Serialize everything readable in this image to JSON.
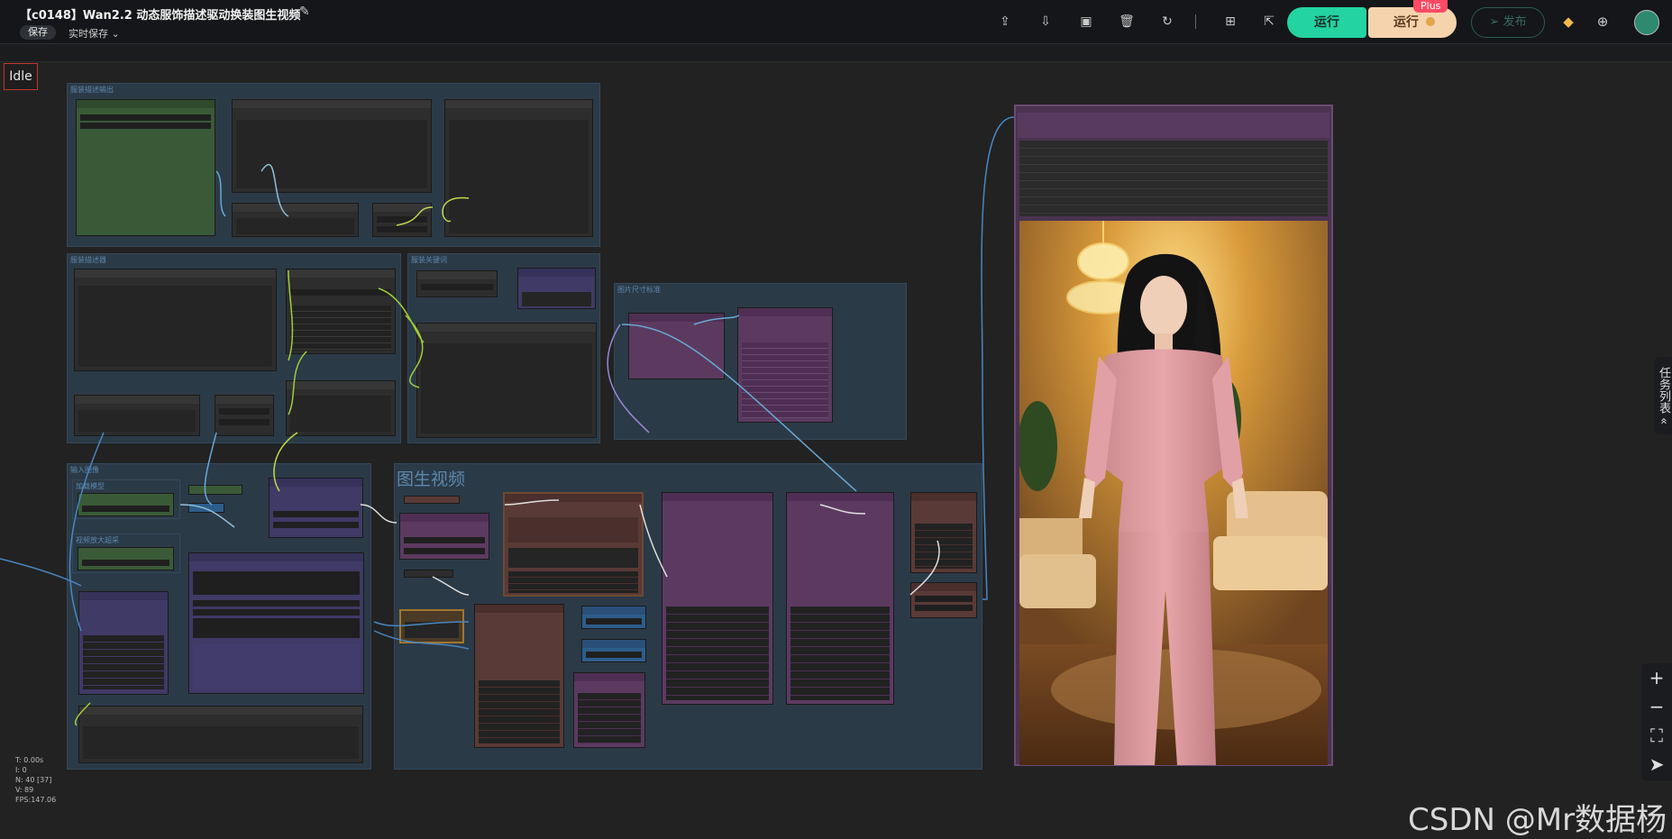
{
  "header": {
    "title": "【c0148】Wan2.2 动态服饰描述驱动换装图生视频",
    "save_label": "保存",
    "autosave_label": "实时保存",
    "run_label": "运行",
    "run_plus_label": "运行",
    "plus_badge": "Plus",
    "publish_label": "发布"
  },
  "icons": {
    "edit": "pencil-icon",
    "upload": "cloud-upload-icon",
    "download": "cloud-download-icon",
    "gallery": "gallery-icon",
    "delete": "trash-icon",
    "refresh": "refresh-icon",
    "grid": "grid-icon",
    "export": "export-icon"
  },
  "status": {
    "idle": "Idle"
  },
  "groups": {
    "g1": "服装描述输出",
    "g2": "服装描述器",
    "g3": "服装关键词",
    "g4": "图片尺寸标准",
    "g5": "输入图像",
    "g6": "图生视频",
    "sub1": "加载模型",
    "sub2": "视频放大超采"
  },
  "stats": {
    "t": "T: 0.00s",
    "i": "I: 0",
    "n": "N: 40 [37]",
    "v": "V: 89",
    "fps": "FPS:147.06"
  },
  "side_panel": {
    "label": "任务列表 «"
  },
  "watermark": "CSDN @Mr数据杨",
  "zoom": {
    "in": "+",
    "out": "−",
    "fit": "⛶",
    "nav": "➤"
  },
  "colors": {
    "accent": "#23d3a2",
    "plus": "#f4d3ad",
    "badge": "#ff4b63"
  }
}
